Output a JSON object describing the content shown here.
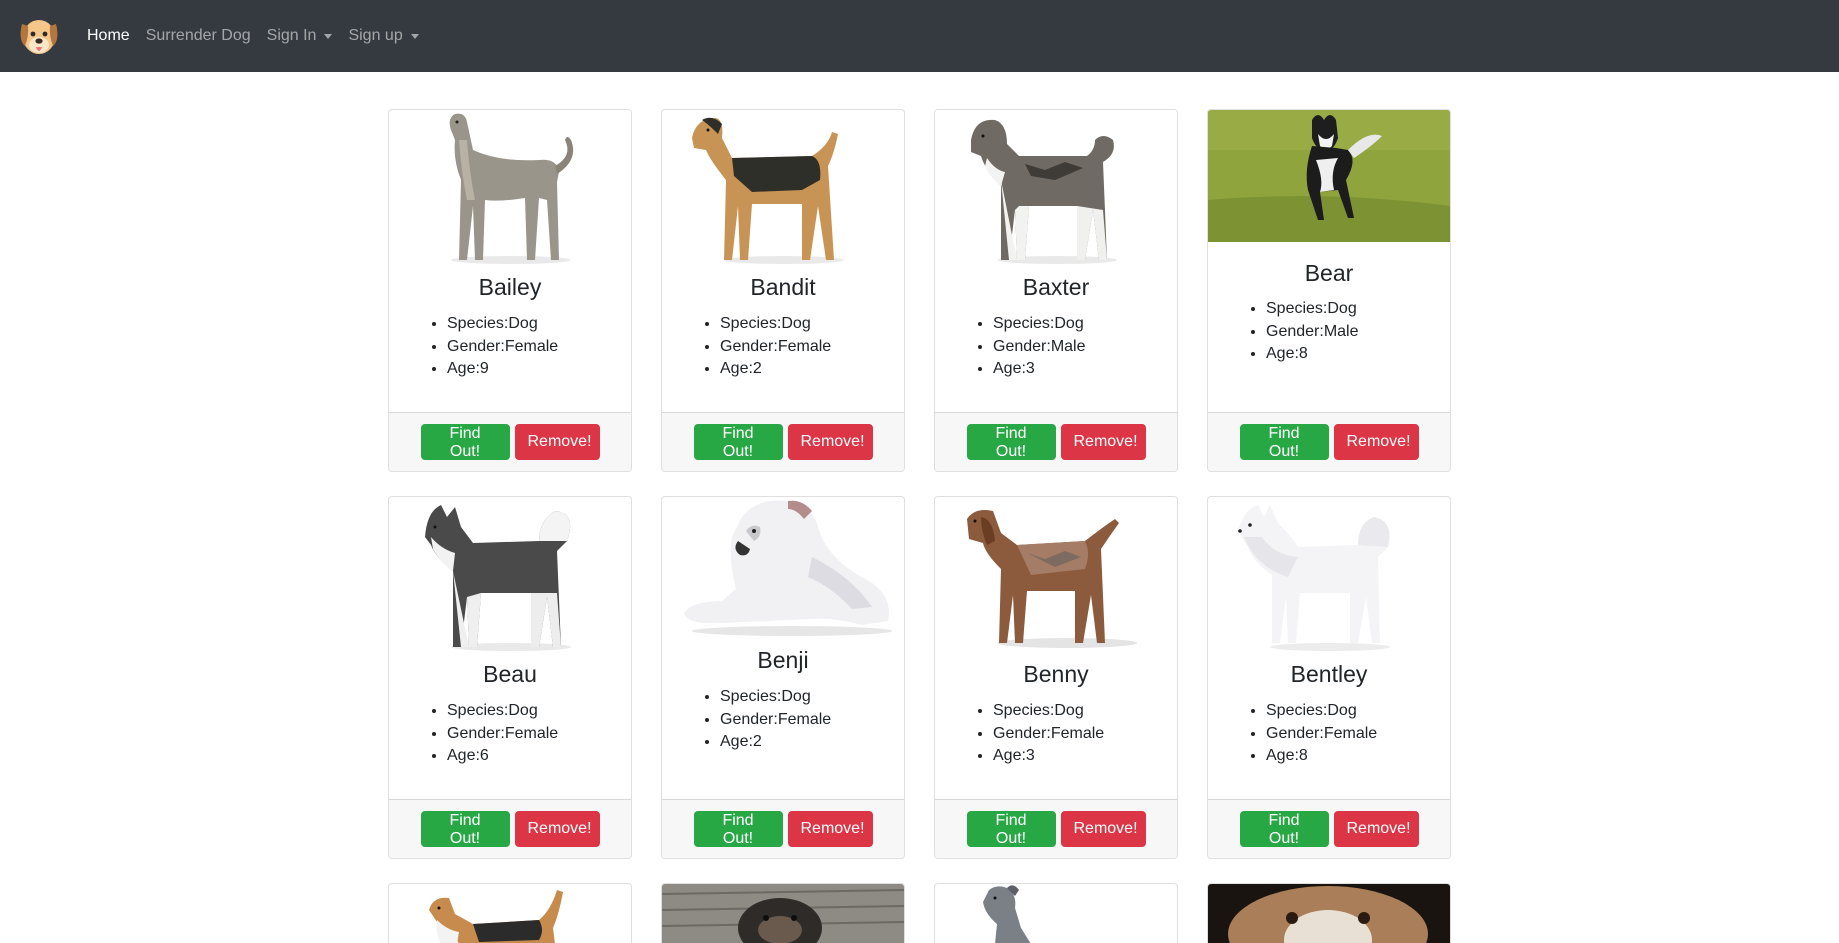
{
  "navbar": {
    "logo": "dog-logo-icon",
    "items": [
      {
        "label": "Home",
        "active": true,
        "dropdown": false
      },
      {
        "label": "Surrender Dog",
        "active": false,
        "dropdown": false
      },
      {
        "label": "Sign In",
        "active": false,
        "dropdown": true
      },
      {
        "label": "Sign up",
        "active": false,
        "dropdown": true
      }
    ]
  },
  "labels": {
    "find_out": "Find Out!",
    "remove": "Remove!"
  },
  "colors": {
    "navbar": "#343a40",
    "success": "#28a745",
    "danger": "#dc3545"
  },
  "dogs": [
    {
      "name": "Bailey",
      "species": "Species:Dog",
      "gender": "Gender:Female",
      "age": "Age:9",
      "image": "afghan-hound-icon"
    },
    {
      "name": "Bandit",
      "species": "Species:Dog",
      "gender": "Gender:Female",
      "age": "Age:2",
      "image": "airedale-terrier-icon"
    },
    {
      "name": "Baxter",
      "species": "Species:Dog",
      "gender": "Gender:Male",
      "age": "Age:3",
      "image": "akita-icon"
    },
    {
      "name": "Bear",
      "species": "Species:Dog",
      "gender": "Gender:Male",
      "age": "Age:8",
      "image": "husky-on-grass-photo"
    },
    {
      "name": "Beau",
      "species": "Species:Dog",
      "gender": "Gender:Female",
      "age": "Age:6",
      "image": "alaskan-malamute-icon"
    },
    {
      "name": "Benji",
      "species": "Species:Dog",
      "gender": "Gender:Female",
      "age": "Age:2",
      "image": "american-bulldog-icon"
    },
    {
      "name": "Benny",
      "species": "Species:Dog",
      "gender": "Gender:Female",
      "age": "Age:3",
      "image": "english-coonhound-icon"
    },
    {
      "name": "Bentley",
      "species": "Species:Dog",
      "gender": "Gender:Female",
      "age": "Age:8",
      "image": "american-eskimo-dog-icon"
    }
  ],
  "partial_cards": [
    {
      "image": "beagle-icon"
    },
    {
      "image": "puppy-on-deck-photo"
    },
    {
      "image": "pit-bull-icon"
    },
    {
      "image": "boxer-face-photo"
    }
  ]
}
